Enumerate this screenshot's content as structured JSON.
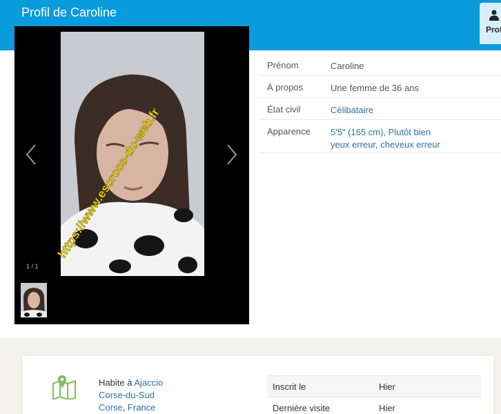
{
  "header": {
    "title": "Profil de Caroline",
    "tab_label": "Prof"
  },
  "gallery": {
    "counter": "1 / 1",
    "watermark": "https://www.escrocs-du-web.fr"
  },
  "details": [
    {
      "label": "Prénom",
      "value": "Caroline",
      "style": "plain"
    },
    {
      "label": "À propos",
      "value": "Une femme de 36 ans",
      "style": "plain"
    },
    {
      "label": "État civil",
      "value": "Célibataire",
      "style": "link"
    },
    {
      "label": "Apparence",
      "value": "5'5\" (165 cm), Plutôt bien yeux erreur, cheveux erreur",
      "style": "link"
    }
  ],
  "location": {
    "prefix": "Habite à ",
    "city": "Ajaccio",
    "region": "Corse-du-Sud",
    "area": "Corse",
    "separator": ", ",
    "country": "France"
  },
  "registration": [
    {
      "label": "Inscrit le",
      "value": "Hier"
    },
    {
      "label": "Dernière visite",
      "value": "Hier"
    }
  ],
  "colors": {
    "header": "#0a9bdc",
    "link": "#2f6fa5",
    "icon_green": "#7dbf5a"
  }
}
